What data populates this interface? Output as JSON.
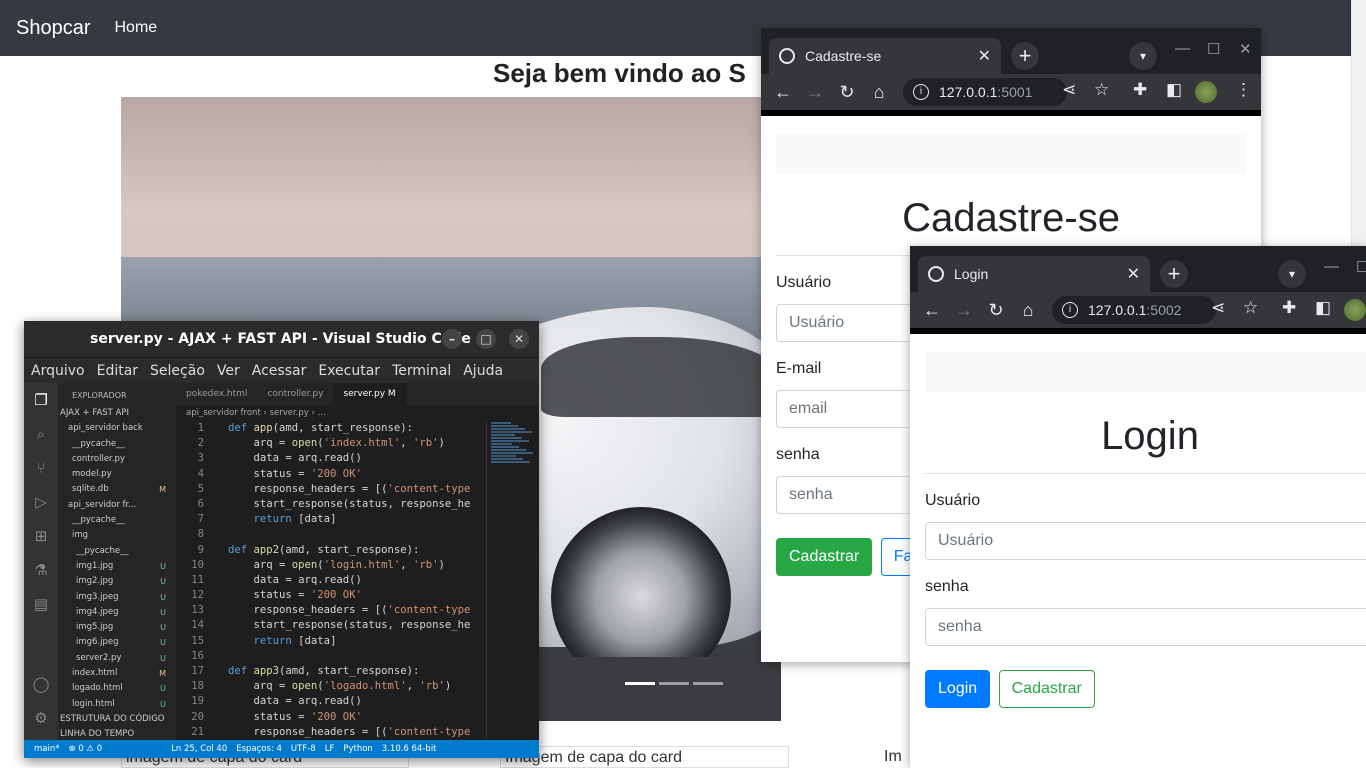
{
  "site": {
    "brand": "Shopcar",
    "nav_home": "Home",
    "welcome": "Seja bem vindo ao S",
    "cards": [
      "imagem de capa do card",
      "Imagem de capa do card",
      "Im"
    ]
  },
  "window1": {
    "tab_title": "Cadastre-se",
    "url_host": "127.0.0.1",
    "url_port": ":5001",
    "heading": "Cadastre-se",
    "label_user": "Usuário",
    "placeholder_user": "Usuário",
    "label_email": "E-mail",
    "placeholder_email": "email",
    "label_pass": "senha",
    "placeholder_pass": "senha",
    "btn_register": "Cadastrar",
    "btn_login_partial": "Fa"
  },
  "window2": {
    "tab_title": "Login",
    "url_host": "127.0.0.1",
    "url_port": ":5002",
    "heading": "Login",
    "label_user": "Usuário",
    "placeholder_user": "Usuário",
    "label_pass": "senha",
    "placeholder_pass": "senha",
    "btn_login": "Login",
    "btn_register": "Cadastrar"
  },
  "vscode": {
    "title": "server.py - AJAX + FAST API - Visual Studio Code",
    "menu": [
      "Arquivo",
      "Editar",
      "Seleção",
      "Ver",
      "Acessar",
      "Executar",
      "Terminal",
      "Ajuda"
    ],
    "explorer_header": "EXPLORADOR",
    "tree": [
      {
        "label": "AJAX + FAST API",
        "badge": ""
      },
      {
        "label": "api_servidor back",
        "badge": ""
      },
      {
        "label": "__pycache__",
        "badge": ""
      },
      {
        "label": "controller.py",
        "badge": ""
      },
      {
        "label": "model.py",
        "badge": ""
      },
      {
        "label": "sqlite.db",
        "badge": "M"
      },
      {
        "label": "api_servidor fr...",
        "badge": ""
      },
      {
        "label": "__pycache__",
        "badge": ""
      },
      {
        "label": "img",
        "badge": ""
      },
      {
        "label": "__pycache__",
        "badge": ""
      },
      {
        "label": "img1.jpg",
        "badge": "U"
      },
      {
        "label": "img2.jpg",
        "badge": "U"
      },
      {
        "label": "img3.jpeg",
        "badge": "U"
      },
      {
        "label": "img4.jpeg",
        "badge": "U"
      },
      {
        "label": "img5.jpg",
        "badge": "U"
      },
      {
        "label": "img6.jpeg",
        "badge": "U"
      },
      {
        "label": "server2.py",
        "badge": "U"
      },
      {
        "label": "index.html",
        "badge": "M"
      },
      {
        "label": "logado.html",
        "badge": "U"
      },
      {
        "label": "login.html",
        "badge": "U"
      },
      {
        "label": "ESTRUTURA DO CÓDIGO",
        "badge": ""
      },
      {
        "label": "LINHA DO TEMPO",
        "badge": ""
      }
    ],
    "tabs": [
      "pokedex.html",
      "controller.py",
      "server.py M"
    ],
    "breadcrumb": "api_servidor front  ›  server.py  ›  ...",
    "code": [
      {
        "n": "1",
        "t": "def app(amd, start_response):"
      },
      {
        "n": "2",
        "t": "    arq = open('index.html', 'rb')"
      },
      {
        "n": "3",
        "t": "    data = arq.read()"
      },
      {
        "n": "4",
        "t": "    status = '200 OK'"
      },
      {
        "n": "5",
        "t": "    response_headers = [('content-type"
      },
      {
        "n": "6",
        "t": "    start_response(status, response_he"
      },
      {
        "n": "7",
        "t": "    return [data]"
      },
      {
        "n": "8",
        "t": ""
      },
      {
        "n": "9",
        "t": "def app2(amd, start_response):"
      },
      {
        "n": "10",
        "t": "    arq = open('login.html', 'rb')"
      },
      {
        "n": "11",
        "t": "    data = arq.read()"
      },
      {
        "n": "12",
        "t": "    status = '200 OK'"
      },
      {
        "n": "13",
        "t": "    response_headers = [('content-type"
      },
      {
        "n": "14",
        "t": "    start_response(status, response_he"
      },
      {
        "n": "15",
        "t": "    return [data]"
      },
      {
        "n": "16",
        "t": ""
      },
      {
        "n": "17",
        "t": "def app3(amd, start_response):"
      },
      {
        "n": "18",
        "t": "    arq = open('logado.html', 'rb')"
      },
      {
        "n": "19",
        "t": "    data = arq.read()"
      },
      {
        "n": "20",
        "t": "    status = '200 OK'"
      },
      {
        "n": "21",
        "t": "    response_headers = [('content-type"
      }
    ],
    "status": [
      "main*",
      "⊗ 0 ⚠ 0",
      "Ln 25, Col 40",
      "Espaços: 4",
      "UTF-8",
      "LF",
      "Python",
      "3.10.6 64-bit"
    ]
  }
}
